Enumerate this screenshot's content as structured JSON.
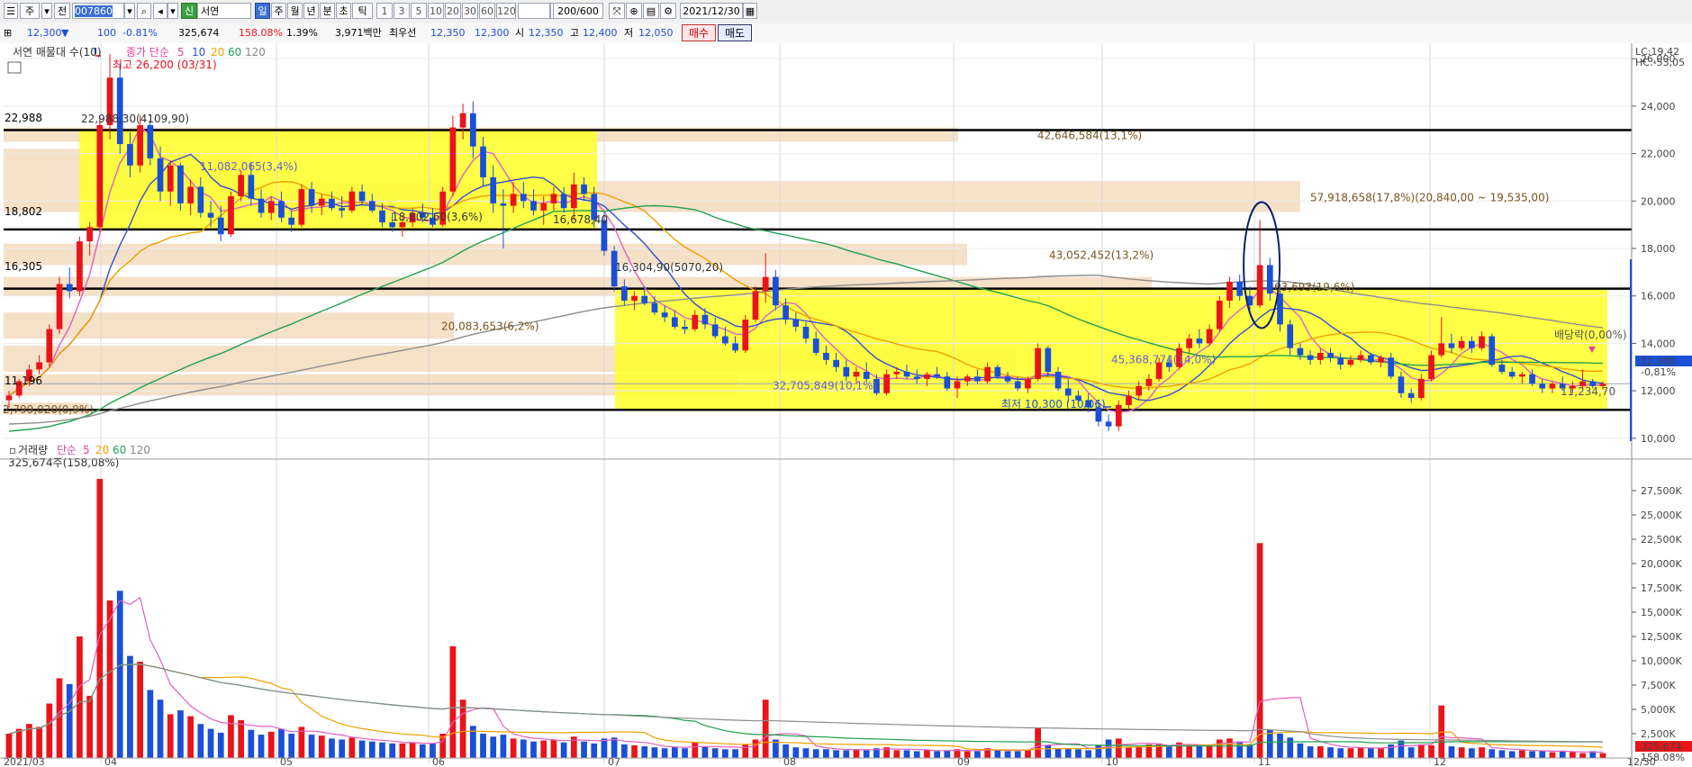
{
  "toolbar": {
    "btn1": "주",
    "btn2": "전",
    "code": "007860",
    "badge": "신",
    "name": "서연",
    "periods": [
      "일",
      "주",
      "월",
      "년",
      "분",
      "초",
      "틱"
    ],
    "active_period": "일",
    "nums": [
      "1",
      "3",
      "5",
      "10",
      "20",
      "30",
      "60",
      "120"
    ],
    "count": "200/600",
    "date": "2021/12/30"
  },
  "quote": {
    "price": "12,300",
    "change": "100",
    "change_pct": "-0.81%",
    "volume": "325,674",
    "vol_ratio": "158.08%",
    "turnover": "1.39%",
    "amount": "3,971백만",
    "best_label": "최우선",
    "best_ask": "12,350",
    "best_bid": "12,300",
    "open_label": "시",
    "open": "12,350",
    "high_label": "고",
    "high": "12,400",
    "low_label": "저",
    "low": "12,050",
    "buy": "매수",
    "sell": "매도"
  },
  "legend": {
    "title": "서연 매물대 수(10)",
    "ma_prefix": "종가 단순",
    "ma_values": [
      "5",
      "10",
      "20",
      "60",
      "120"
    ],
    "ma_colors": [
      "#e040a0",
      "#3050d0",
      "#f0a000",
      "#20a050",
      "#888888"
    ],
    "vol_title": "거래량",
    "vol_prefix": "단순",
    "vol_ma_values": [
      "5",
      "20",
      "60",
      "120"
    ],
    "vol_ma_colors": [
      "#e040a0",
      "#f0a000",
      "#20a050",
      "#888888"
    ],
    "vol_now": "325,674주(158,08%)"
  },
  "annotations": {
    "lc": "LC:19,42",
    "hc": "HC:-53,05",
    "high_mark": "최고 26,200 (03/31)",
    "low_mark": "최저 10,300 (10/06)",
    "ex_div": "배당락(0,00%)",
    "price_tag": "12,300",
    "pct_tag": "-0,81%",
    "vol_tag": "325,674",
    "vol_pct_tag": "158.08%",
    "line_22988": "22,988",
    "line_18802": "18,802",
    "line_16305": "16,305",
    "line_11196": "11,196",
    "line_11234": "11,234,70",
    "box_label_1": "22,988,30(4109,90)",
    "box_label_2": "16,678,40",
    "box_label_3": "16,304,90(5070,20)",
    "box_label_4": "18,802,60(3,6%)"
  },
  "profile": [
    {
      "low": 22500,
      "high": 23100,
      "len": 1060,
      "label": "42,646,584(13,1%)"
    },
    {
      "low": 19535,
      "high": 20840,
      "len": 1440,
      "label": "57,918,658(17,8%)(20,840,00 ~ 19,535,00)"
    },
    {
      "low": 17300,
      "high": 18200,
      "len": 1070,
      "label": "43,052,452(13,2%)"
    },
    {
      "low": 16000,
      "high": 16800,
      "len": 1275,
      "label": "63,693(19,6%)"
    },
    {
      "low": 20800,
      "high": 22200,
      "len": 275,
      "label": "11,082,065(3,4%)"
    },
    {
      "low": 14200,
      "high": 15300,
      "len": 500,
      "label": "20,083,653(6,2%)"
    },
    {
      "low": 12800,
      "high": 13900,
      "len": 1125,
      "label": "45,368,774(14,0%)"
    },
    {
      "low": 11800,
      "high": 12700,
      "len": 815,
      "label": "32,705,849(10,1%)"
    },
    {
      "low": 11000,
      "high": 11500,
      "len": 95,
      "label": "2,799,020(0,9%)"
    }
  ],
  "hlines": [
    22988,
    18802,
    16305,
    11196
  ],
  "price_axis": [
    "26,000",
    "24,000",
    "22,000",
    "20,000",
    "18,000",
    "16,000",
    "14,000",
    "12,000",
    "10,000"
  ],
  "volume_axis": [
    "27,500K",
    "25,000K",
    "22,500K",
    "20,000K",
    "17,500K",
    "15,000K",
    "12,500K",
    "10,000K",
    "7,500K",
    "5,000K",
    "2,500K"
  ],
  "months": [
    "2021/03",
    "04",
    "05",
    "06",
    "07",
    "08",
    "09",
    "10",
    "11",
    "12",
    "12/30"
  ],
  "colors": {
    "up": "#e8141a",
    "down": "#1a4fd6",
    "box": "#ffff33",
    "profile": "#f5e0c8"
  },
  "chart_data": {
    "type": "candlestick",
    "ylim": [
      9500,
      26500
    ],
    "ohlc": [
      [
        11600,
        12000,
        11300,
        11800
      ],
      [
        11800,
        12500,
        11700,
        12400
      ],
      [
        12400,
        13100,
        12200,
        12900
      ],
      [
        12900,
        13500,
        12700,
        13200
      ],
      [
        13200,
        14800,
        13000,
        14600
      ],
      [
        14600,
        16800,
        14400,
        16500
      ],
      [
        16500,
        17200,
        15900,
        16200
      ],
      [
        16200,
        18500,
        16000,
        18300
      ],
      [
        18300,
        19100,
        17700,
        18900
      ],
      [
        18900,
        23500,
        18700,
        23200
      ],
      [
        23200,
        26200,
        22600,
        25200
      ],
      [
        25200,
        25800,
        22000,
        22400
      ],
      [
        22400,
        22900,
        21000,
        21500
      ],
      [
        21500,
        23600,
        21200,
        23200
      ],
      [
        23200,
        23400,
        21500,
        21800
      ],
      [
        21800,
        22300,
        20000,
        20400
      ],
      [
        20400,
        21700,
        19800,
        21500
      ],
      [
        21500,
        21600,
        19600,
        19900
      ],
      [
        19900,
        20900,
        19400,
        20600
      ],
      [
        20600,
        21000,
        19300,
        19500
      ],
      [
        19500,
        20000,
        18900,
        19300
      ],
      [
        19300,
        19800,
        18300,
        18600
      ],
      [
        18600,
        20400,
        18500,
        20200
      ],
      [
        20200,
        21300,
        20000,
        21100
      ],
      [
        21100,
        21600,
        19800,
        20100
      ],
      [
        20100,
        20500,
        19300,
        19500
      ],
      [
        19500,
        20200,
        19200,
        20000
      ],
      [
        20000,
        20400,
        19100,
        19300
      ],
      [
        19300,
        19600,
        18700,
        19000
      ],
      [
        19000,
        20700,
        18900,
        20500
      ],
      [
        20500,
        20800,
        19500,
        19800
      ],
      [
        19800,
        20300,
        19400,
        20100
      ],
      [
        20100,
        20400,
        19600,
        19700
      ],
      [
        19700,
        20200,
        19300,
        19600
      ],
      [
        19600,
        20600,
        19500,
        20400
      ],
      [
        20400,
        20700,
        19800,
        20000
      ],
      [
        20000,
        20300,
        19500,
        19600
      ],
      [
        19600,
        19900,
        18900,
        19100
      ],
      [
        19100,
        19500,
        18700,
        18900
      ],
      [
        18900,
        19300,
        18500,
        19100
      ],
      [
        19100,
        19700,
        18900,
        19500
      ],
      [
        19500,
        19900,
        19100,
        19300
      ],
      [
        19300,
        19700,
        18900,
        19000
      ],
      [
        19000,
        20600,
        18900,
        20400
      ],
      [
        20400,
        23600,
        20200,
        23100
      ],
      [
        23100,
        24100,
        22600,
        23700
      ],
      [
        23700,
        24200,
        21800,
        22300
      ],
      [
        22300,
        22700,
        20600,
        21000
      ],
      [
        21000,
        21500,
        19500,
        19900
      ],
      [
        19900,
        20500,
        18000,
        19800
      ],
      [
        19800,
        20800,
        19500,
        20300
      ],
      [
        20300,
        20800,
        19700,
        20000
      ],
      [
        20000,
        20500,
        19400,
        19600
      ],
      [
        19600,
        20200,
        19000,
        19900
      ],
      [
        19900,
        20600,
        19600,
        20300
      ],
      [
        20300,
        20600,
        19500,
        19700
      ],
      [
        19700,
        21200,
        19200,
        20700
      ],
      [
        20700,
        21000,
        20000,
        20300
      ],
      [
        20300,
        20600,
        18900,
        19200
      ],
      [
        19200,
        19500,
        17700,
        17900
      ],
      [
        17900,
        18100,
        16200,
        16400
      ],
      [
        16400,
        16700,
        15600,
        15800
      ],
      [
        15800,
        16200,
        15400,
        16000
      ],
      [
        16000,
        16400,
        15600,
        15700
      ],
      [
        15700,
        16000,
        15200,
        15300
      ],
      [
        15300,
        15600,
        14900,
        15100
      ],
      [
        15100,
        15400,
        14600,
        14700
      ],
      [
        14700,
        15000,
        14400,
        14600
      ],
      [
        14600,
        15400,
        14500,
        15200
      ],
      [
        15200,
        15500,
        14600,
        14800
      ],
      [
        14800,
        15100,
        14200,
        14300
      ],
      [
        14300,
        14700,
        13900,
        14000
      ],
      [
        14000,
        14300,
        13600,
        13700
      ],
      [
        13700,
        15200,
        13600,
        15000
      ],
      [
        15000,
        16400,
        14900,
        16200
      ],
      [
        16200,
        17800,
        15700,
        16800
      ],
      [
        16800,
        17100,
        15400,
        15600
      ],
      [
        15600,
        15900,
        14800,
        15000
      ],
      [
        15000,
        15300,
        14500,
        14700
      ],
      [
        14700,
        14900,
        14000,
        14200
      ],
      [
        14200,
        14500,
        13500,
        13600
      ],
      [
        13600,
        13900,
        13100,
        13300
      ],
      [
        13300,
        13600,
        12800,
        13000
      ],
      [
        13000,
        13300,
        12400,
        12600
      ],
      [
        12600,
        13000,
        12300,
        12800
      ],
      [
        12800,
        13200,
        12400,
        12500
      ],
      [
        12500,
        12700,
        11800,
        11900
      ],
      [
        11900,
        12900,
        11800,
        12700
      ],
      [
        12700,
        13000,
        12500,
        12800
      ],
      [
        12800,
        13100,
        12500,
        12600
      ],
      [
        12600,
        12900,
        12300,
        12500
      ],
      [
        12500,
        12800,
        12200,
        12700
      ],
      [
        12700,
        13000,
        12500,
        12600
      ],
      [
        12600,
        12800,
        12000,
        12100
      ],
      [
        12100,
        12600,
        11700,
        12400
      ],
      [
        12400,
        12700,
        12200,
        12600
      ],
      [
        12600,
        12900,
        12300,
        12400
      ],
      [
        12400,
        13200,
        12300,
        13000
      ],
      [
        13000,
        13100,
        12500,
        12600
      ],
      [
        12600,
        12800,
        12300,
        12400
      ],
      [
        12400,
        12600,
        12000,
        12100
      ],
      [
        12100,
        12600,
        11900,
        12500
      ],
      [
        12500,
        14000,
        12400,
        13800
      ],
      [
        13800,
        13900,
        12600,
        12800
      ],
      [
        12800,
        13000,
        12000,
        12100
      ],
      [
        12100,
        12500,
        11500,
        11800
      ],
      [
        11800,
        12000,
        11400,
        11600
      ],
      [
        11600,
        11900,
        11100,
        11300
      ],
      [
        11300,
        11600,
        10500,
        10700
      ],
      [
        10700,
        11000,
        10300,
        10500
      ],
      [
        10500,
        11600,
        10300,
        11400
      ],
      [
        11400,
        12000,
        11200,
        11800
      ],
      [
        11800,
        12400,
        11600,
        12200
      ],
      [
        12200,
        12700,
        12000,
        12500
      ],
      [
        12500,
        13400,
        12400,
        13200
      ],
      [
        13200,
        13500,
        12800,
        13000
      ],
      [
        13000,
        14000,
        12900,
        13800
      ],
      [
        13800,
        14400,
        13600,
        14200
      ],
      [
        14200,
        14600,
        13800,
        14000
      ],
      [
        14000,
        14800,
        13900,
        14600
      ],
      [
        14600,
        16000,
        14500,
        15800
      ],
      [
        15800,
        16800,
        15500,
        16600
      ],
      [
        16600,
        16900,
        15800,
        16000
      ],
      [
        16000,
        16400,
        15400,
        15600
      ],
      [
        15600,
        19200,
        15500,
        17300
      ],
      [
        17300,
        17600,
        15800,
        16100
      ],
      [
        16100,
        16500,
        14500,
        14800
      ],
      [
        14800,
        15000,
        13500,
        13800
      ],
      [
        13800,
        14000,
        13300,
        13500
      ],
      [
        13500,
        13700,
        13100,
        13300
      ],
      [
        13300,
        13800,
        13100,
        13600
      ],
      [
        13600,
        13800,
        13200,
        13400
      ],
      [
        13400,
        13600,
        12900,
        13100
      ],
      [
        13100,
        13500,
        13000,
        13300
      ],
      [
        13300,
        13700,
        13200,
        13500
      ],
      [
        13500,
        13600,
        13100,
        13200
      ],
      [
        13200,
        13500,
        13000,
        13400
      ],
      [
        13400,
        13600,
        12500,
        12600
      ],
      [
        12600,
        12800,
        11700,
        11900
      ],
      [
        11900,
        12100,
        11500,
        11700
      ],
      [
        11700,
        12700,
        11600,
        12500
      ],
      [
        12500,
        13700,
        12400,
        13500
      ],
      [
        13500,
        15100,
        13400,
        14000
      ],
      [
        14000,
        14400,
        13600,
        13800
      ],
      [
        13800,
        14300,
        13700,
        14100
      ],
      [
        14100,
        14300,
        13600,
        13800
      ],
      [
        13800,
        14500,
        13700,
        14300
      ],
      [
        14300,
        14400,
        13000,
        13100
      ],
      [
        13100,
        13300,
        12700,
        12800
      ],
      [
        12800,
        13000,
        12500,
        12600
      ],
      [
        12600,
        12800,
        12300,
        12700
      ],
      [
        12700,
        12900,
        12200,
        12300
      ],
      [
        12300,
        12500,
        11900,
        12100
      ],
      [
        12100,
        12400,
        11900,
        12300
      ],
      [
        12300,
        12600,
        12000,
        12100
      ],
      [
        12100,
        12400,
        11900,
        12200
      ],
      [
        12200,
        12900,
        12100,
        12400
      ],
      [
        12400,
        12500,
        12100,
        12200
      ],
      [
        12200,
        12400,
        12050,
        12300
      ]
    ],
    "volume": [
      2500,
      3000,
      3500,
      3200,
      5600,
      8200,
      7600,
      12500,
      6400,
      28700,
      16200,
      17200,
      10500,
      9900,
      7000,
      6000,
      4500,
      4900,
      4300,
      3500,
      3000,
      2600,
      4400,
      3900,
      2900,
      2400,
      2700,
      3000,
      2500,
      3200,
      2400,
      2300,
      2000,
      1900,
      2100,
      1800,
      1700,
      1600,
      1500,
      1500,
      1600,
      1400,
      1500,
      2500,
      11500,
      6000,
      3300,
      2500,
      2200,
      2400,
      2000,
      1900,
      1700,
      1800,
      1900,
      1600,
      2200,
      1700,
      1500,
      2000,
      2100,
      1400,
      1300,
      1200,
      1100,
      1000,
      1100,
      1000,
      1600,
      1200,
      1000,
      900,
      900,
      1400,
      1900,
      6000,
      1900,
      1400,
      1100,
      1000,
      900,
      900,
      800,
      800,
      900,
      800,
      1000,
      1100,
      800,
      800,
      700,
      800,
      700,
      800,
      900,
      700,
      700,
      1000,
      800,
      700,
      700,
      800,
      3100,
      1300,
      1000,
      1000,
      900,
      800,
      1300,
      1900,
      2000,
      1100,
      1200,
      1400,
      1500,
      1200,
      1600,
      1300,
      1200,
      1300,
      1900,
      2000,
      1700,
      1400,
      22100,
      2900,
      2500,
      2100,
      1500,
      1200,
      1200,
      1100,
      1000,
      1000,
      1100,
      1000,
      1000,
      1400,
      1800,
      1100,
      1400,
      1300,
      5400,
      1200,
      1100,
      1000,
      1100,
      900,
      800,
      700,
      800,
      700,
      700,
      600,
      700,
      600,
      500,
      700,
      500
    ]
  }
}
